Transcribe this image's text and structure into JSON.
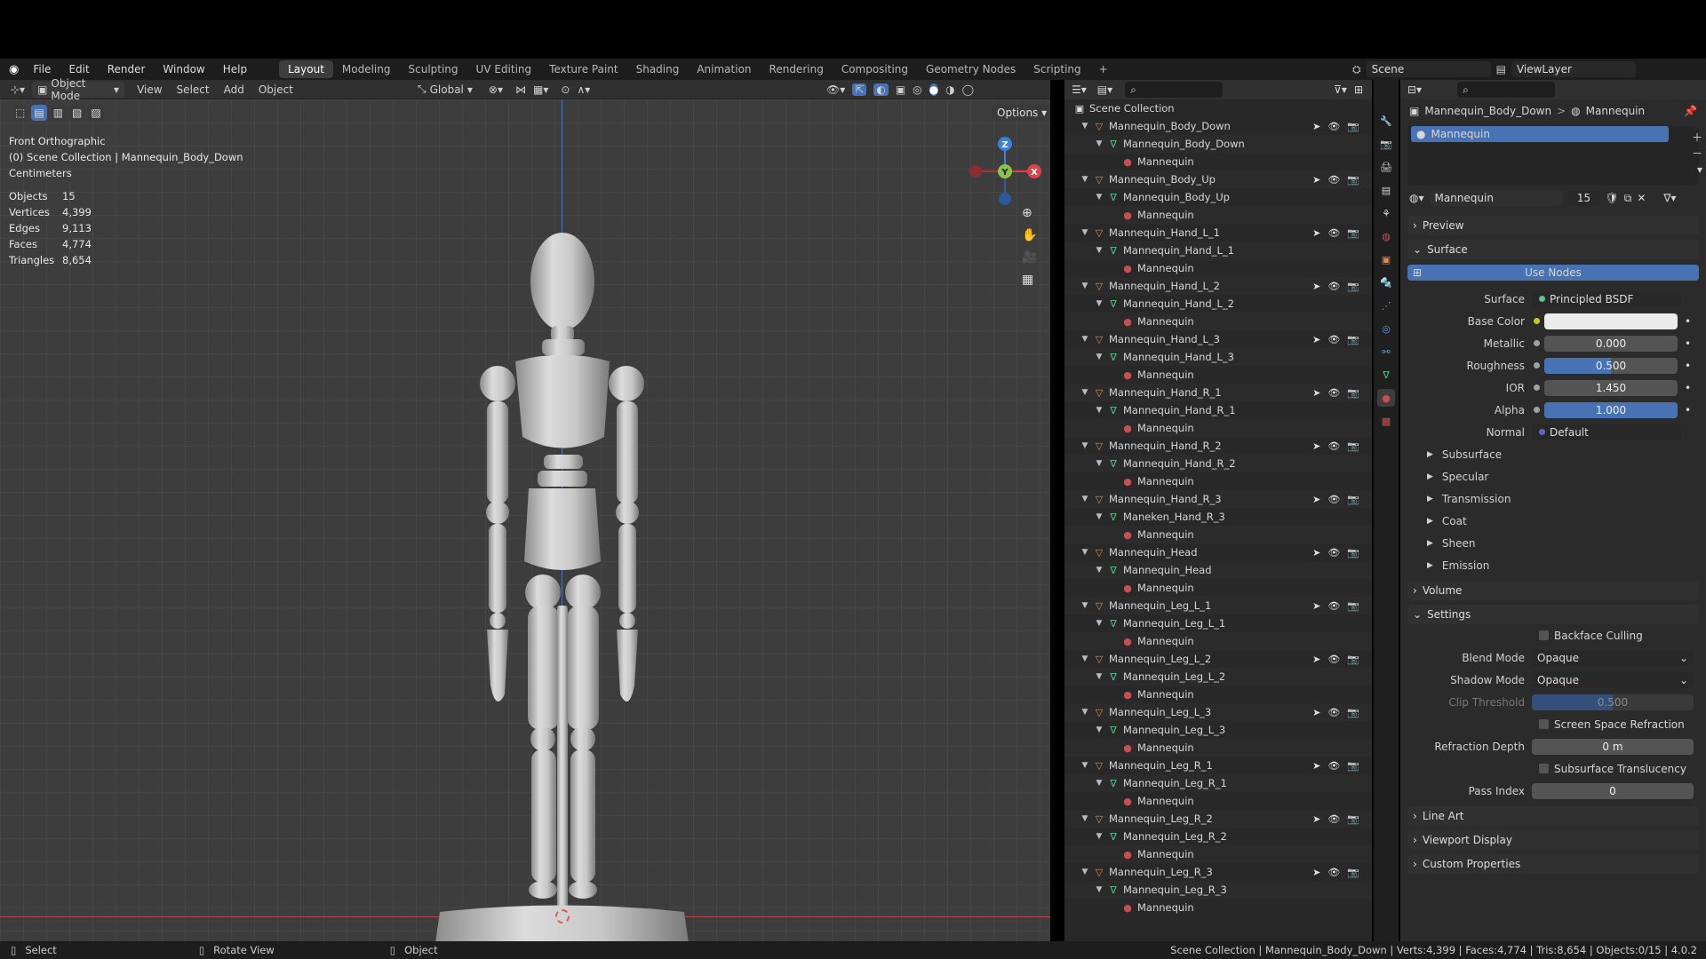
{
  "menu": [
    "File",
    "Edit",
    "Render",
    "Window",
    "Help"
  ],
  "workspaces": [
    "Layout",
    "Modeling",
    "Sculpting",
    "UV Editing",
    "Texture Paint",
    "Shading",
    "Animation",
    "Rendering",
    "Compositing",
    "Geometry Nodes",
    "Scripting"
  ],
  "active_workspace": "Layout",
  "add_tab": "+",
  "scene": "Scene",
  "view_layer": "ViewLayer",
  "viewport_header": {
    "mode": "Object Mode",
    "view": "View",
    "select": "Select",
    "add": "Add",
    "object": "Object",
    "orientation": "Global",
    "options": "Options"
  },
  "viewport_info": {
    "view_name": "Front Orthographic",
    "collection": "(0) Scene Collection | Mannequin_Body_Down",
    "units": "Centimeters",
    "stats": [
      {
        "k": "Objects",
        "v": "15"
      },
      {
        "k": "Vertices",
        "v": "4,399"
      },
      {
        "k": "Edges",
        "v": "9,113"
      },
      {
        "k": "Faces",
        "v": "4,774"
      },
      {
        "k": "Triangles",
        "v": "8,654"
      }
    ]
  },
  "gizmo": {
    "z": "Z",
    "y": "Y",
    "x": "X"
  },
  "outliner": {
    "root": "Scene Collection",
    "objects": [
      {
        "obj": "Mannequin_Body_Down",
        "mesh": "Mannequin_Body_Down",
        "mat": "Mannequin"
      },
      {
        "obj": "Mannequin_Body_Up",
        "mesh": "Mannequin_Body_Up",
        "mat": "Mannequin"
      },
      {
        "obj": "Mannequin_Hand_L_1",
        "mesh": "Mannequin_Hand_L_1",
        "mat": "Mannequin"
      },
      {
        "obj": "Mannequin_Hand_L_2",
        "mesh": "Mannequin_Hand_L_2",
        "mat": "Mannequin"
      },
      {
        "obj": "Mannequin_Hand_L_3",
        "mesh": "Mannequin_Hand_L_3",
        "mat": "Mannequin"
      },
      {
        "obj": "Mannequin_Hand_R_1",
        "mesh": "Mannequin_Hand_R_1",
        "mat": "Mannequin"
      },
      {
        "obj": "Mannequin_Hand_R_2",
        "mesh": "Mannequin_Hand_R_2",
        "mat": "Mannequin"
      },
      {
        "obj": "Mannequin_Hand_R_3",
        "mesh": "Maneken_Hand_R_3",
        "mat": "Mannequin"
      },
      {
        "obj": "Mannequin_Head",
        "mesh": "Mannequin_Head",
        "mat": "Mannequin"
      },
      {
        "obj": "Mannequin_Leg_L_1",
        "mesh": "Mannequin_Leg_L_1",
        "mat": "Mannequin"
      },
      {
        "obj": "Mannequin_Leg_L_2",
        "mesh": "Mannequin_Leg_L_2",
        "mat": "Mannequin"
      },
      {
        "obj": "Mannequin_Leg_L_3",
        "mesh": "Mannequin_Leg_L_3",
        "mat": "Mannequin"
      },
      {
        "obj": "Mannequin_Leg_R_1",
        "mesh": "Mannequin_Leg_R_1",
        "mat": "Mannequin"
      },
      {
        "obj": "Mannequin_Leg_R_2",
        "mesh": "Mannequin_Leg_R_2",
        "mat": "Mannequin"
      },
      {
        "obj": "Mannequin_Leg_R_3",
        "mesh": "Mannequin_Leg_R_3",
        "mat": "Mannequin"
      }
    ]
  },
  "properties": {
    "breadcrumb_obj": "Mannequin_Body_Down",
    "breadcrumb_sep": ">",
    "breadcrumb_mat": "Mannequin",
    "slot": "Mannequin",
    "material_name": "Mannequin",
    "users": "15",
    "preview": "Preview",
    "surface_panel": "Surface",
    "use_nodes": "Use Nodes",
    "surface_label": "Surface",
    "surface_value": "Principled BSDF",
    "base_color_label": "Base Color",
    "metallic_label": "Metallic",
    "metallic": "0.000",
    "roughness_label": "Roughness",
    "roughness": "0.500",
    "ior_label": "IOR",
    "ior": "1.450",
    "alpha_label": "Alpha",
    "alpha": "1.000",
    "normal_label": "Normal",
    "normal": "Default",
    "subpanels": [
      "Subsurface",
      "Specular",
      "Transmission",
      "Coat",
      "Sheen",
      "Emission"
    ],
    "volume": "Volume",
    "settings": "Settings",
    "backface": "Backface Culling",
    "blend_label": "Blend Mode",
    "blend": "Opaque",
    "shadow_label": "Shadow Mode",
    "shadow": "Opaque",
    "clip_label": "Clip Threshold",
    "clip": "0.500",
    "ssr": "Screen Space Refraction",
    "refr_label": "Refraction Depth",
    "refr": "0 m",
    "sss": "Subsurface Translucency",
    "pass_label": "Pass Index",
    "pass": "0",
    "line_art": "Line Art",
    "viewport_display": "Viewport Display",
    "custom_props": "Custom Properties"
  },
  "status": {
    "select": "Select",
    "rotate": "Rotate View",
    "object": "Object",
    "right": "Scene Collection | Mannequin_Body_Down | Verts:4,399 | Faces:4,774 | Tris:8,654 | Objects:0/15 | 4.0.2"
  },
  "colors": {
    "accent": "#4772b3",
    "object_icon": "#e88a3e",
    "mesh_icon": "#5fc28e",
    "material_icon": "#c94f4f",
    "axis_x": "#e2404a",
    "axis_y": "#8bc34a",
    "axis_z": "#3f7fd4"
  }
}
